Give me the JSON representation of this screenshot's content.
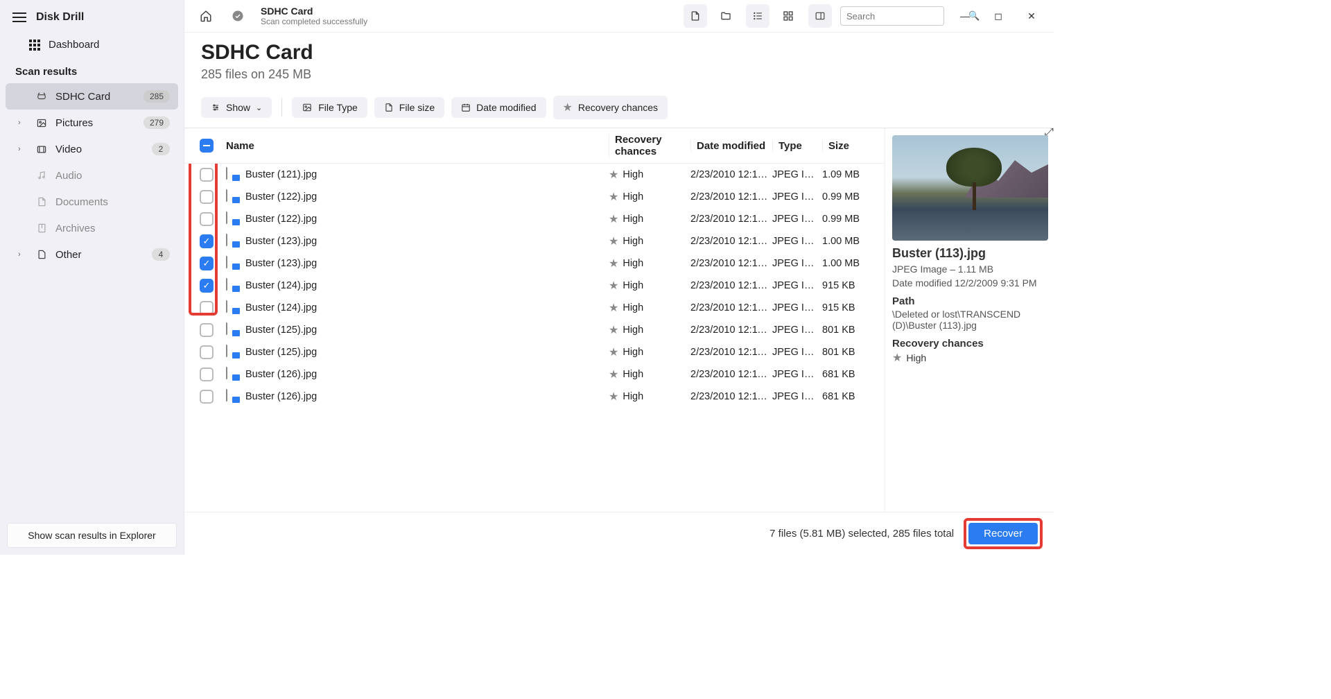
{
  "app": {
    "name": "Disk Drill"
  },
  "sidebar": {
    "dashboard": "Dashboard",
    "section": "Scan results",
    "items": [
      {
        "label": "SDHC Card",
        "badge": "285",
        "active": true,
        "arrow": false,
        "icon": "drive"
      },
      {
        "label": "Pictures",
        "badge": "279",
        "arrow": true,
        "icon": "image"
      },
      {
        "label": "Video",
        "badge": "2",
        "arrow": true,
        "icon": "video"
      },
      {
        "label": "Audio",
        "badge": "",
        "arrow": false,
        "icon": "audio",
        "muted": true
      },
      {
        "label": "Documents",
        "badge": "",
        "arrow": false,
        "icon": "doc",
        "muted": true
      },
      {
        "label": "Archives",
        "badge": "",
        "arrow": false,
        "icon": "archive",
        "muted": true
      },
      {
        "label": "Other",
        "badge": "4",
        "arrow": true,
        "icon": "other"
      }
    ],
    "explorer": "Show scan results in Explorer"
  },
  "topbar": {
    "title": "SDHC Card",
    "subtitle": "Scan completed successfully",
    "search_placeholder": "Search"
  },
  "header": {
    "title": "SDHC Card",
    "subtitle": "285 files on 245 MB"
  },
  "filters": {
    "show": "Show",
    "file_type": "File Type",
    "file_size": "File size",
    "date_modified": "Date modified",
    "recovery": "Recovery chances"
  },
  "columns": {
    "name": "Name",
    "recovery": "Recovery chances",
    "date": "Date modified",
    "type": "Type",
    "size": "Size"
  },
  "files": [
    {
      "name": "Buster (121).jpg",
      "recovery": "High",
      "date": "2/23/2010 12:10…",
      "type": "JPEG Im…",
      "size": "1.09 MB",
      "checked": false
    },
    {
      "name": "Buster (122).jpg",
      "recovery": "High",
      "date": "2/23/2010 12:10…",
      "type": "JPEG Im…",
      "size": "0.99 MB",
      "checked": false
    },
    {
      "name": "Buster (122).jpg",
      "recovery": "High",
      "date": "2/23/2010 12:10…",
      "type": "JPEG Im…",
      "size": "0.99 MB",
      "checked": false
    },
    {
      "name": "Buster (123).jpg",
      "recovery": "High",
      "date": "2/23/2010 12:10…",
      "type": "JPEG Im…",
      "size": "1.00 MB",
      "checked": true
    },
    {
      "name": "Buster (123).jpg",
      "recovery": "High",
      "date": "2/23/2010 12:10…",
      "type": "JPEG Im…",
      "size": "1.00 MB",
      "checked": true
    },
    {
      "name": "Buster (124).jpg",
      "recovery": "High",
      "date": "2/23/2010 12:10…",
      "type": "JPEG Im…",
      "size": "915 KB",
      "checked": true
    },
    {
      "name": "Buster (124).jpg",
      "recovery": "High",
      "date": "2/23/2010 12:10…",
      "type": "JPEG Im…",
      "size": "915 KB",
      "checked": false
    },
    {
      "name": "Buster (125).jpg",
      "recovery": "High",
      "date": "2/23/2010 12:11…",
      "type": "JPEG Im…",
      "size": "801 KB",
      "checked": false
    },
    {
      "name": "Buster (125).jpg",
      "recovery": "High",
      "date": "2/23/2010 12:11…",
      "type": "JPEG Im…",
      "size": "801 KB",
      "checked": false
    },
    {
      "name": "Buster (126).jpg",
      "recovery": "High",
      "date": "2/23/2010 12:11…",
      "type": "JPEG Im…",
      "size": "681 KB",
      "checked": false
    },
    {
      "name": "Buster (126).jpg",
      "recovery": "High",
      "date": "2/23/2010 12:11…",
      "type": "JPEG Im…",
      "size": "681 KB",
      "checked": false
    }
  ],
  "preview": {
    "title": "Buster (113).jpg",
    "meta": "JPEG Image – 1.11 MB",
    "modified": "Date modified 12/2/2009 9:31 PM",
    "path_label": "Path",
    "path": "\\Deleted or lost\\TRANSCEND (D)\\Buster (113).jpg",
    "chances_label": "Recovery chances",
    "chances": "High"
  },
  "footer": {
    "status": "7 files (5.81 MB) selected, 285 files total",
    "recover": "Recover"
  }
}
